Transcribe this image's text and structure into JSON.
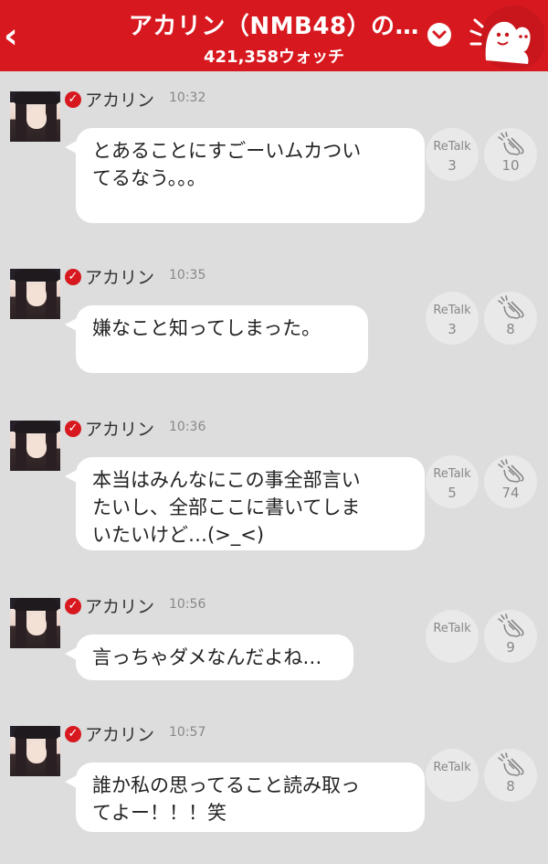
{
  "header": {
    "title": "アカリン（NMB48）の…",
    "watch_count": "421,358ウォッチ",
    "back_label": "‹",
    "dropdown_icon": "chevron-down-icon",
    "mascot_icon": "mascot-icon"
  },
  "messages": [
    {
      "name": "アカリン",
      "time": "10:32",
      "lines": [
        "とあることにすごーいムカつい",
        "てるなう。。。"
      ],
      "retalk_label": "ReTalk",
      "retalk": "3",
      "claps": "10"
    },
    {
      "name": "アカリン",
      "time": "10:35",
      "lines": [
        "嫌なこと知ってしまった。"
      ],
      "retalk_label": "ReTalk",
      "retalk": "3",
      "claps": "8"
    },
    {
      "name": "アカリン",
      "time": "10:36",
      "lines": [
        "本当はみんなにこの事全部言い",
        "たいし、全部ここに書いてしま",
        "いたいけど…(>_<)"
      ],
      "retalk_label": "ReTalk",
      "retalk": "5",
      "claps": "74"
    },
    {
      "name": "アカリン",
      "time": "10:56",
      "lines": [
        "言っちゃダメなんだよね…"
      ],
      "retalk_label": "ReTalk",
      "retalk": "",
      "claps": "9"
    },
    {
      "name": "アカリン",
      "time": "10:57",
      "lines": [
        "誰か私の思ってること読み取っ",
        "てよー！！！笑"
      ],
      "retalk_label": "ReTalk",
      "retalk": "",
      "claps": "8"
    }
  ],
  "colors": {
    "accent": "#d7191f",
    "background": "#dddddd",
    "bubble": "#ffffff"
  }
}
